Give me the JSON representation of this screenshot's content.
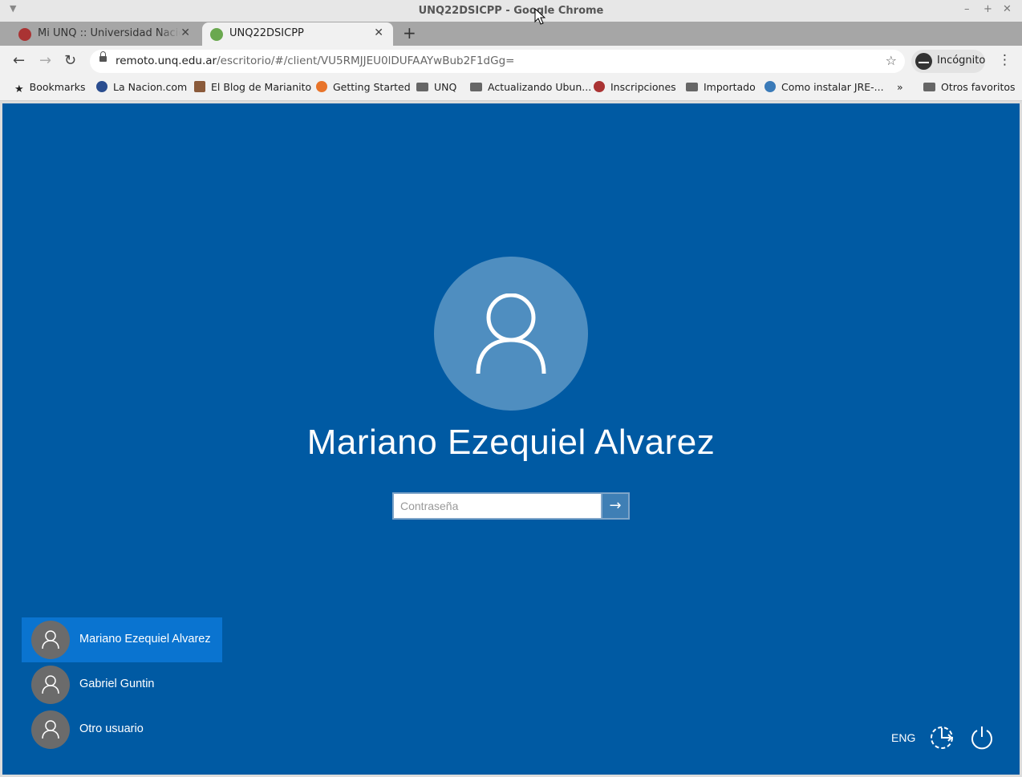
{
  "window": {
    "title": "UNQ22DSICPP - Google Chrome"
  },
  "tabs": [
    {
      "label": "Mi UNQ :: Universidad Nacional de Quilmes",
      "favicon": "unq-icon",
      "color": "#a33"
    },
    {
      "label": "UNQ22DSICPP",
      "favicon": "guacamole-icon",
      "color": "#6aa84f"
    }
  ],
  "toolbar": {
    "url_host": "remoto.unq.edu.ar",
    "url_path": "/escritorio/#/client/VU5RMJJEU0lDUFAAYwBub2F1dGg=",
    "incognito_label": "Incógnito"
  },
  "bookmarks": [
    {
      "label": "Bookmarks",
      "icon": "star-icon"
    },
    {
      "label": "La Nacion.com",
      "icon": "lanacion-icon"
    },
    {
      "label": "El Blog de Marianito",
      "icon": "blog-icon"
    },
    {
      "label": "Getting Started",
      "icon": "firefox-icon"
    },
    {
      "label": "UNQ",
      "icon": "folder-icon"
    },
    {
      "label": "Actualizando Ubun...",
      "icon": "folder-icon"
    },
    {
      "label": "Inscripciones",
      "icon": "unq-icon"
    },
    {
      "label": "Importado",
      "icon": "folder-icon"
    },
    {
      "label": "Como instalar JRE-...",
      "icon": "wordpress-icon"
    },
    {
      "label": "Otros favoritos",
      "icon": "folder-icon"
    }
  ],
  "login": {
    "username": "Mariano Ezequiel Alvarez",
    "password_placeholder": "Contraseña",
    "users": [
      {
        "name": "Mariano Ezequiel Alvarez",
        "selected": true
      },
      {
        "name": "Gabriel Guntin",
        "selected": false
      },
      {
        "name": "Otro usuario",
        "selected": false
      }
    ],
    "language": "ENG"
  },
  "colors": {
    "background": "#005aa3",
    "selected_user": "#0a74d0"
  }
}
